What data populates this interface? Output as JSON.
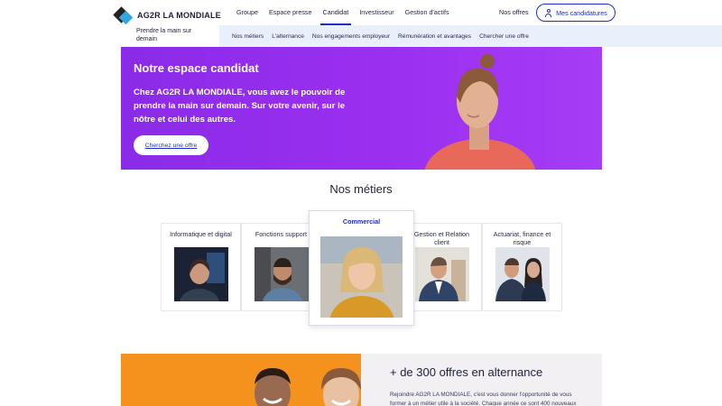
{
  "header": {
    "logo_text": "AG2R LA MONDIALE",
    "tagline": "Prendre la main sur demain",
    "nav": [
      {
        "label": "Groupe"
      },
      {
        "label": "Espace presse"
      },
      {
        "label": "Candidat",
        "active": true
      },
      {
        "label": "Investisseur"
      },
      {
        "label": "Gestion d'actifs"
      }
    ],
    "offres_link": "Nos offres",
    "candidatures_button": "Mes candidatures"
  },
  "sub_nav": [
    {
      "label": "Nos métiers"
    },
    {
      "label": "L'alternance"
    },
    {
      "label": "Nos engagements employeur"
    },
    {
      "label": "Rémunération et avantages"
    },
    {
      "label": "Chercher une offre"
    }
  ],
  "hero": {
    "title": "Notre espace candidat",
    "text": "Chez AG2R LA MONDIALE, vous avez le pouvoir de prendre la main sur demain. Sur votre avenir, sur le nôtre et celui des autres.",
    "button": "Cherchez une offre"
  },
  "metiers": {
    "title": "Nos métiers",
    "cards": [
      {
        "label": "Informatique et digital"
      },
      {
        "label": "Fonctions support"
      },
      {
        "label": "Commercial",
        "featured": true
      },
      {
        "label": "Gestion et Relation client"
      },
      {
        "label": "Actuariat, finance et risque"
      }
    ]
  },
  "alternance": {
    "title": "+ de 300 offres en alternance",
    "text": "Rejoindre AG2R LA MONDIALE, c'est vous donner l'opportunité de vous former à un métier utile à la société. Chaque année ce sont 400 nouveaux"
  },
  "colors": {
    "brand_blue": "#1c2fbf",
    "hero_purple": "#9b2ff0",
    "alternance_orange": "#f5921e",
    "subnav_bg": "#eaf0fb"
  }
}
